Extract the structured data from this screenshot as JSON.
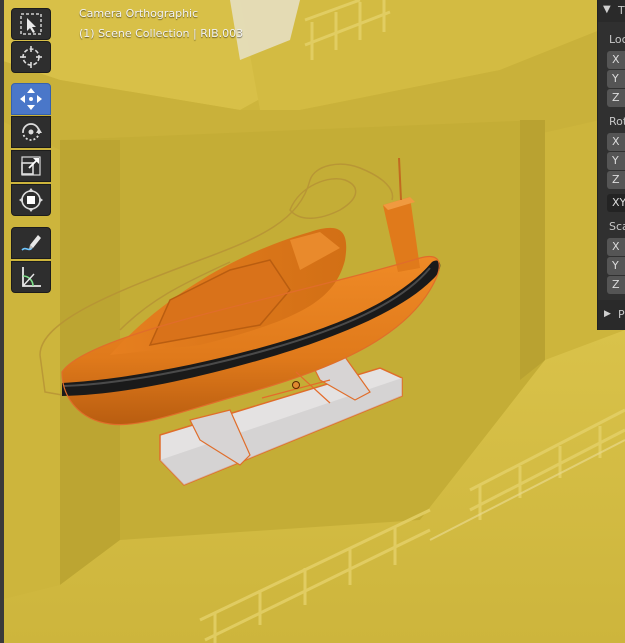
{
  "viewport": {
    "title": "Camera Orthographic",
    "info": "(1) Scene Collection | RIB.003"
  },
  "toolbar": {
    "tools": [
      {
        "name": "select-box-tool",
        "icon": "cursor-box-icon",
        "active": false
      },
      {
        "name": "cursor-tool",
        "icon": "3d-cursor-icon",
        "active": false
      },
      {
        "name": "move-tool",
        "icon": "move-arrows-icon",
        "active": true
      },
      {
        "name": "rotate-tool",
        "icon": "rotate-icon",
        "active": false
      },
      {
        "name": "scale-tool",
        "icon": "scale-icon",
        "active": false
      },
      {
        "name": "transform-tool",
        "icon": "transform-icon",
        "active": false
      },
      {
        "name": "annotate-tool",
        "icon": "annotate-pencil-icon",
        "active": false
      },
      {
        "name": "measure-tool",
        "icon": "measure-ruler-icon",
        "active": false
      }
    ]
  },
  "npanel": {
    "header": "T",
    "location_label": "Loc",
    "location_fields": [
      "X",
      "Y",
      "Z"
    ],
    "rotation_label": "Rot",
    "rotation_fields": [
      "X",
      "Y",
      "Z"
    ],
    "rotation_mode": "XY",
    "scale_label": "Sca",
    "scale_fields": [
      "X",
      "Y",
      "Z"
    ],
    "collapsed_section": "P"
  },
  "colors": {
    "ship": "#cdb53c",
    "boat_hull": "#e07a1b",
    "fender": "#1a1a1a",
    "cradle": "#e4e2e2",
    "selection_outline": "#e06d2a",
    "active_tool": "#4a77c9"
  }
}
